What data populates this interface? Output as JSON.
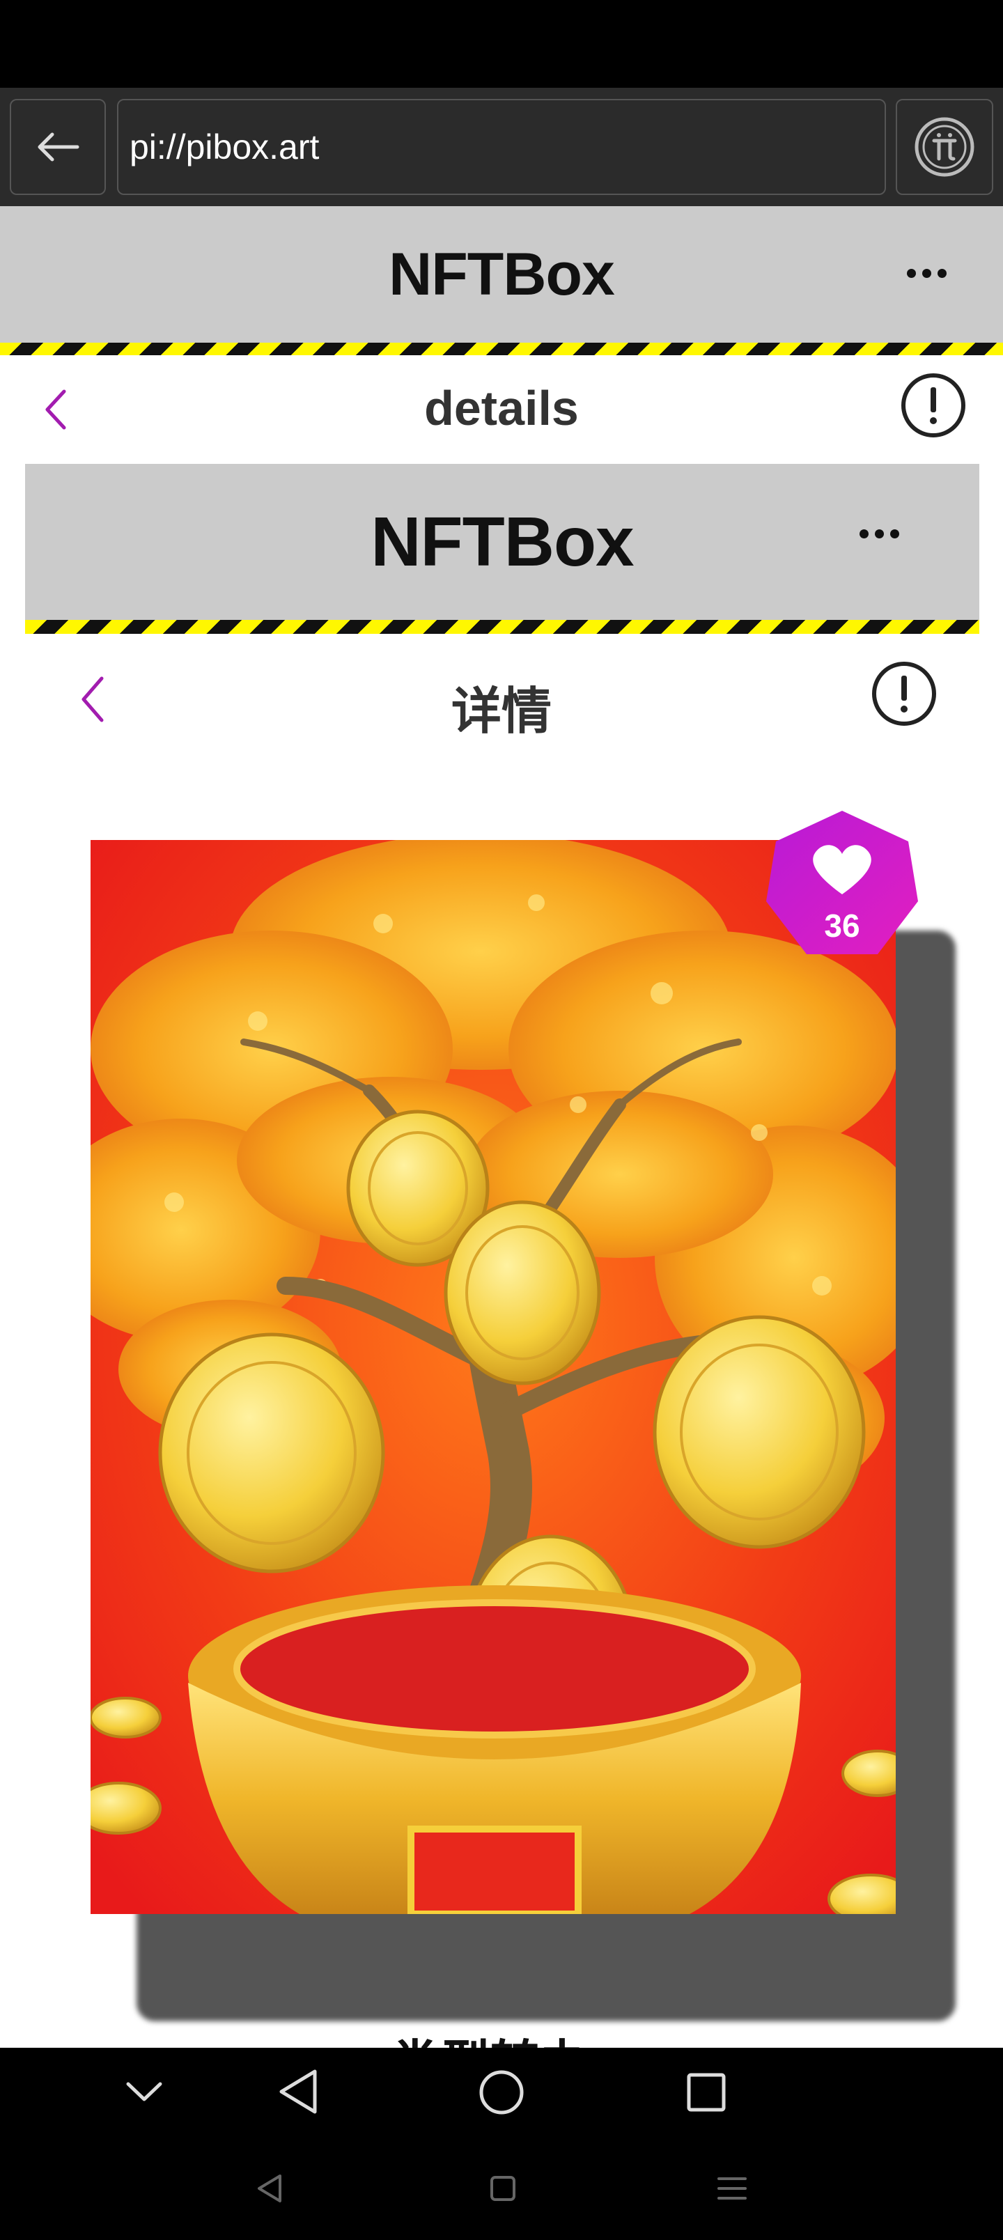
{
  "browser": {
    "url": "pi://pibox.art"
  },
  "app": {
    "outer_title": "NFTBox",
    "outer_subtitle": "details",
    "inner_title": "NFTBox",
    "inner_subtitle": "详情"
  },
  "nft": {
    "like_count": "36",
    "section_heading_partial": "类型转办"
  },
  "colors": {
    "accent_purple": "#a21caf",
    "header_gray": "#cbcbcb",
    "stripe_yellow": "#fff700"
  },
  "icons": [
    "back-arrow-icon",
    "pi-icon",
    "more-icon",
    "chevron-left-icon",
    "info-icon",
    "heart-icon",
    "chevron-down-icon",
    "triangle-back-icon",
    "circle-home-icon",
    "square-recents-icon",
    "menu-icon"
  ]
}
